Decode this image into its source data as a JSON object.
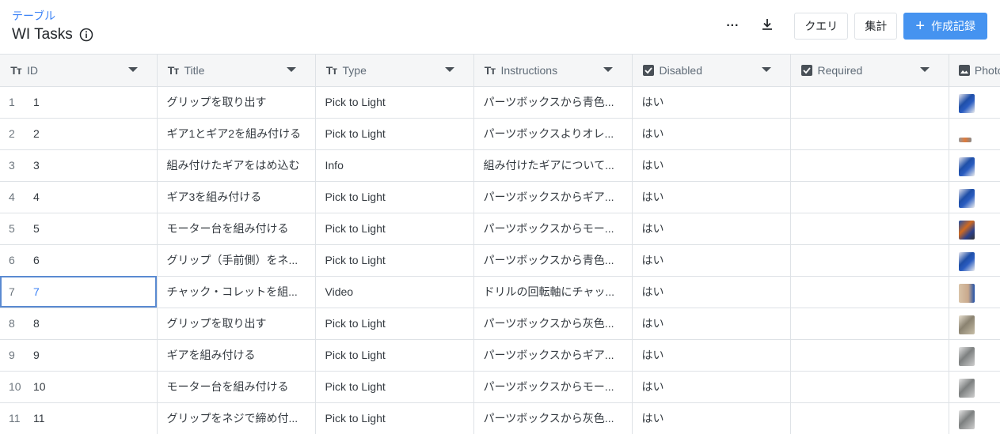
{
  "header": {
    "breadcrumb": "テーブル",
    "title": "WI Tasks"
  },
  "toolbar": {
    "more_label": "···",
    "query_label": "クエリ",
    "aggregate_label": "集計",
    "create_label": "作成記録"
  },
  "columns": [
    {
      "label": "ID",
      "icon": "text-type-icon"
    },
    {
      "label": "Title",
      "icon": "text-type-icon"
    },
    {
      "label": "Type",
      "icon": "text-type-icon"
    },
    {
      "label": "Instructions",
      "icon": "text-type-icon"
    },
    {
      "label": "Disabled",
      "icon": "checkbox-icon"
    },
    {
      "label": "Required",
      "icon": "checkbox-icon"
    },
    {
      "label": "Photo",
      "icon": "image-icon"
    }
  ],
  "rows": [
    {
      "num": "1",
      "id": "1",
      "title": "グリップを取り出す",
      "type": "Pick to Light",
      "instructions": "パーツボックスから青色...",
      "disabled": "はい",
      "required": "",
      "photo": "blue"
    },
    {
      "num": "2",
      "id": "2",
      "title": "ギア1とギア2を組み付ける",
      "type": "Pick to Light",
      "instructions": "パーツボックスよりオレ...",
      "disabled": "はい",
      "required": "",
      "photo": "small"
    },
    {
      "num": "3",
      "id": "3",
      "title": "組み付けたギアをはめ込む",
      "type": "Info",
      "instructions": "組み付けたギアについて...",
      "disabled": "はい",
      "required": "",
      "photo": "blue"
    },
    {
      "num": "4",
      "id": "4",
      "title": "ギア3を組み付ける",
      "type": "Pick to Light",
      "instructions": "パーツボックスからギア...",
      "disabled": "はい",
      "required": "",
      "photo": "blue"
    },
    {
      "num": "5",
      "id": "5",
      "title": "モーター台を組み付ける",
      "type": "Pick to Light",
      "instructions": "パーツボックスからモー...",
      "disabled": "はい",
      "required": "",
      "photo": "multi"
    },
    {
      "num": "6",
      "id": "6",
      "title": "グリップ（手前側）をネ...",
      "type": "Pick to Light",
      "instructions": "パーツボックスから青色...",
      "disabled": "はい",
      "required": "",
      "photo": "blue"
    },
    {
      "num": "7",
      "id": "7",
      "title": "チャック・コレットを組...",
      "type": "Video",
      "instructions": "ドリルの回転軸にチャッ...",
      "disabled": "はい",
      "required": "",
      "photo": "hand"
    },
    {
      "num": "8",
      "id": "8",
      "title": "グリップを取り出す",
      "type": "Pick to Light",
      "instructions": "パーツボックスから灰色...",
      "disabled": "はい",
      "required": "",
      "photo": "tan"
    },
    {
      "num": "9",
      "id": "9",
      "title": "ギアを組み付ける",
      "type": "Pick to Light",
      "instructions": "パーツボックスからギア...",
      "disabled": "はい",
      "required": "",
      "photo": "gray"
    },
    {
      "num": "10",
      "id": "10",
      "title": "モーター台を組み付ける",
      "type": "Pick to Light",
      "instructions": "パーツボックスからモー...",
      "disabled": "はい",
      "required": "",
      "photo": "gray"
    },
    {
      "num": "11",
      "id": "11",
      "title": "グリップをネジで締め付...",
      "type": "Pick to Light",
      "instructions": "パーツボックスから灰色...",
      "disabled": "はい",
      "required": "",
      "photo": "gray"
    }
  ],
  "selected_row": 6,
  "colors": {
    "accent": "#4593f0",
    "link": "#3b82f6",
    "header_bg": "#f5f6f7",
    "border": "#dee2e6"
  }
}
